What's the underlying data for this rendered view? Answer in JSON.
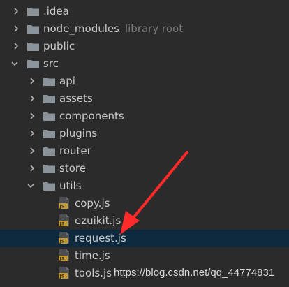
{
  "tree": {
    "items": [
      {
        "label": ".idea",
        "type": "folder",
        "state": "collapsed",
        "hint": ""
      },
      {
        "label": "node_modules",
        "type": "folder",
        "state": "collapsed",
        "hint": "library root"
      },
      {
        "label": "public",
        "type": "folder",
        "state": "collapsed",
        "hint": ""
      },
      {
        "label": "src",
        "type": "folder",
        "state": "expanded",
        "hint": ""
      },
      {
        "label": "api",
        "type": "folder",
        "state": "collapsed",
        "hint": ""
      },
      {
        "label": "assets",
        "type": "folder",
        "state": "collapsed",
        "hint": ""
      },
      {
        "label": "components",
        "type": "folder",
        "state": "collapsed",
        "hint": ""
      },
      {
        "label": "plugins",
        "type": "folder",
        "state": "collapsed",
        "hint": ""
      },
      {
        "label": "router",
        "type": "folder",
        "state": "collapsed",
        "hint": ""
      },
      {
        "label": "store",
        "type": "folder",
        "state": "collapsed",
        "hint": ""
      },
      {
        "label": "utils",
        "type": "folder",
        "state": "expanded",
        "hint": ""
      },
      {
        "label": "copy.js",
        "type": "js-file",
        "hint": ""
      },
      {
        "label": "ezuikit.js",
        "type": "js-file",
        "hint": ""
      },
      {
        "label": "request.js",
        "type": "js-file",
        "hint": "",
        "selected": true
      },
      {
        "label": "time.js",
        "type": "js-file",
        "hint": ""
      },
      {
        "label": "tools.js",
        "type": "js-file",
        "hint": ""
      }
    ]
  },
  "watermark": "https://blog.csdn.net/qq_44774831",
  "annotation": {
    "type": "red-arrow",
    "color": "#ff2a2a",
    "target": "request.js"
  },
  "colors": {
    "background": "#2b2b2b",
    "selection": "#0d293e",
    "text": "#c8c8c8",
    "hint": "#7a7a7a",
    "folder": "#8a9399",
    "js_badge": "#c79a2e"
  },
  "icons": {
    "folder": "folder-icon",
    "js": "js-file-icon",
    "collapsed": "chevron-right-icon",
    "expanded": "chevron-down-icon"
  }
}
